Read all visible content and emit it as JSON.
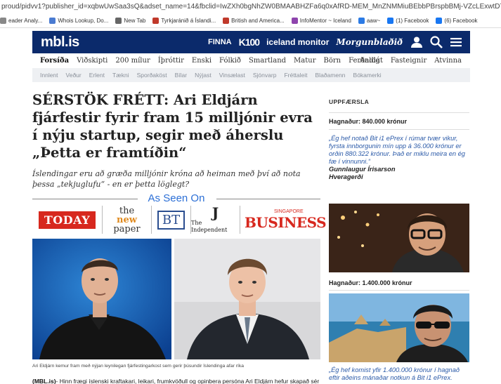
{
  "browser": {
    "url": "proud/pidvv1?publisher_id=xqbwUwSaa3sQ&adset_name=14&fbclid=IwZXh0bgNhZW0BMAABHZFa6q0xAfRD-MEM_MnZNMMiuBEbbPBrspbBMj-VZcLExwtDTUifClmovA_aem_wYfC_5r5hE7kMSrUGc1Cbw&",
    "bookmarks": [
      {
        "label": "eader Analy...",
        "color": "#888888"
      },
      {
        "label": "Whois Lookup, Do...",
        "color": "#4a7bd1"
      },
      {
        "label": "New Tab",
        "color": "#666666"
      },
      {
        "label": "Tyrkjaránið á Íslandi...",
        "color": "#c0392b"
      },
      {
        "label": "British and America...",
        "color": "#c0392b"
      },
      {
        "label": "InfoMentor ~ Iceland",
        "color": "#8e44ad"
      },
      {
        "label": "aaw~",
        "color": "#2c7be5"
      },
      {
        "label": "(1) Facebook",
        "color": "#1877f2"
      },
      {
        "label": "(6) Facebook",
        "color": "#1877f2"
      }
    ]
  },
  "header": {
    "logo": "mbl.is",
    "partners": [
      "FINNA",
      "K100",
      "iceland monitor",
      "Morgunblaðið"
    ],
    "icons": [
      "user-icon",
      "search-icon",
      "menu-icon"
    ]
  },
  "section_nav": {
    "left": [
      "Forsíða",
      "Viðskipti",
      "200 mílur",
      "Íþróttir",
      "Enski",
      "Fólkið",
      "Smartland",
      "Matur",
      "Börn",
      "Ferðalög"
    ],
    "right": [
      "Andlát",
      "Fasteignir",
      "Atvinna"
    ],
    "active": "Forsíða"
  },
  "sub_nav": [
    "Innlent",
    "Veður",
    "Erlent",
    "Tækni",
    "Sporðaköst",
    "Bílar",
    "Nýjast",
    "Vinsælast",
    "Sjónvarp",
    "Fréttaleit",
    "Blaðamenn",
    "Bókamerki"
  ],
  "article": {
    "headline": "SÉRSTÖK FRÉTT: Ari Eldjárn fjárfestir fyrir fram 15 milljónir evra í nýju startup, segir með áherslu „Þetta er framtíðin“",
    "lede": "Íslendingar eru að græða milljónir króna að heiman með því að nota þessa „tekjuglufu“ - en er þetta löglegt?",
    "as_seen_on": "As Seen On",
    "media_logos": {
      "today": "TODAY",
      "nnp": [
        "the",
        "new",
        "paper"
      ],
      "bt": "BT",
      "independent": [
        "J",
        "The Independent"
      ],
      "business": [
        "SINGAPORE",
        "BUSINESS"
      ]
    },
    "caption": "Ari Eldjárn kemur fram með nýjan leynilegan fjárfestingarkost sem gerir þúsundir Íslendinga afar ríka",
    "body_lead": "(MBL.is)",
    "body": "- Hinn frægi íslenski kraftakari, leikari, frumkvöðull og opinbera persóna Ari Eldjárn hefur skapað sér"
  },
  "sidebar": {
    "heading": "UPPFÆRSLA",
    "entries": [
      {
        "earned": "Hagnaður: 840.000 krónur",
        "quote_before": "„Ég hef notað ",
        "quote_link": "Bit i1 ePrex",
        "quote_after": " í rúmar tvær vikur, fyrsta innborgunin mín upp á 36.000 krónur er orðin 880.322 krónur. Það er miklu meira en ég fæ í vinnunni.“",
        "author": "Gunnlaugur Írisarson",
        "place": "Hveragerði"
      },
      {
        "earned": "Hagnaður: 1.400.000 krónur",
        "quote_before": "„Ég hef komist yfir 1.400.000 krónur í hagnað eftir aðeins mánaðar notkun á ",
        "quote_link": "Bit i1 ePrex",
        "quote_after": "."
      }
    ]
  }
}
